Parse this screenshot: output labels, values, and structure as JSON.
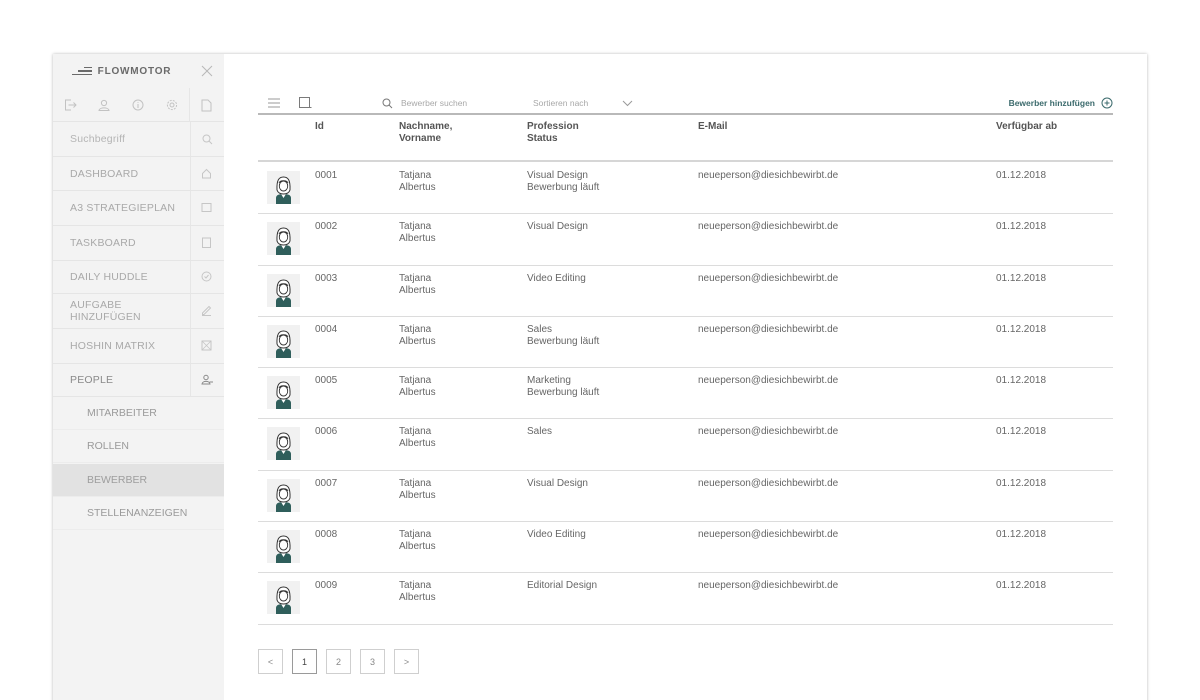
{
  "app": {
    "brand": "FLOWMOTOR"
  },
  "sidebar": {
    "search_placeholder": "Suchbegriff",
    "nav": [
      {
        "label": "DASHBOARD",
        "icon": "home-icon"
      },
      {
        "label": "A3 STRATEGIEPLAN",
        "icon": "square-icon"
      },
      {
        "label": "TASKBOARD",
        "icon": "clipboard-icon"
      },
      {
        "label": "DAILY HUDDLE",
        "icon": "check-circle-icon"
      },
      {
        "label": "AUFGABE HINZUFÜGEN",
        "icon": "pencil-icon"
      },
      {
        "label": "HOSHIN MATRIX",
        "icon": "matrix-icon"
      },
      {
        "label": "PEOPLE",
        "icon": "people-icon"
      }
    ],
    "sub": [
      {
        "label": "MITARBEITER"
      },
      {
        "label": "ROLLEN"
      },
      {
        "label": "BEWERBER"
      },
      {
        "label": "STELLENANZEIGEN"
      }
    ]
  },
  "toolbar": {
    "search_placeholder": "Bewerber suchen",
    "sort_label": "Sortieren nach",
    "add_label": "Bewerber hinzufügen"
  },
  "table": {
    "headers": {
      "id": "Id",
      "name": "Nachname,\nVorname",
      "profession": "Profession\nStatus",
      "email": "E-Mail",
      "available": "Verfügbar ab"
    },
    "rows": [
      {
        "id": "0001",
        "first": "Tatjana",
        "last": "Albertus",
        "profession": "Visual Design",
        "status": "Bewerbung läuft",
        "email": "neueperson@diesichbewirbt.de",
        "date": "01.12.2018"
      },
      {
        "id": "0002",
        "first": "Tatjana",
        "last": "Albertus",
        "profession": "Visual Design",
        "status": "",
        "email": "neueperson@diesichbewirbt.de",
        "date": "01.12.2018"
      },
      {
        "id": "0003",
        "first": "Tatjana",
        "last": "Albertus",
        "profession": "Video Editing",
        "status": "",
        "email": "neueperson@diesichbewirbt.de",
        "date": "01.12.2018"
      },
      {
        "id": "0004",
        "first": "Tatjana",
        "last": "Albertus",
        "profession": "Sales",
        "status": "Bewerbung läuft",
        "email": "neueperson@diesichbewirbt.de",
        "date": "01.12.2018"
      },
      {
        "id": "0005",
        "first": "Tatjana",
        "last": "Albertus",
        "profession": "Marketing",
        "status": "Bewerbung läuft",
        "email": "neueperson@diesichbewirbt.de",
        "date": "01.12.2018"
      },
      {
        "id": "0006",
        "first": "Tatjana",
        "last": "Albertus",
        "profession": "Sales",
        "status": "",
        "email": "neueperson@diesichbewirbt.de",
        "date": "01.12.2018"
      },
      {
        "id": "0007",
        "first": "Tatjana",
        "last": "Albertus",
        "profession": "Visual Design",
        "status": "",
        "email": "neueperson@diesichbewirbt.de",
        "date": "01.12.2018"
      },
      {
        "id": "0008",
        "first": "Tatjana",
        "last": "Albertus",
        "profession": "Video Editing",
        "status": "",
        "email": "neueperson@diesichbewirbt.de",
        "date": "01.12.2018"
      },
      {
        "id": "0009",
        "first": "Tatjana",
        "last": "Albertus",
        "profession": "Editorial Design",
        "status": "",
        "email": "neueperson@diesichbewirbt.de",
        "date": "01.12.2018"
      }
    ]
  },
  "pagination": {
    "prev": "<",
    "pages": [
      "1",
      "2",
      "3"
    ],
    "next": ">",
    "current": "1"
  },
  "colors": {
    "accent": "#3b6a6c",
    "sidebar_bg": "#f3f3f3",
    "selected_bg": "#e2e2e2"
  }
}
